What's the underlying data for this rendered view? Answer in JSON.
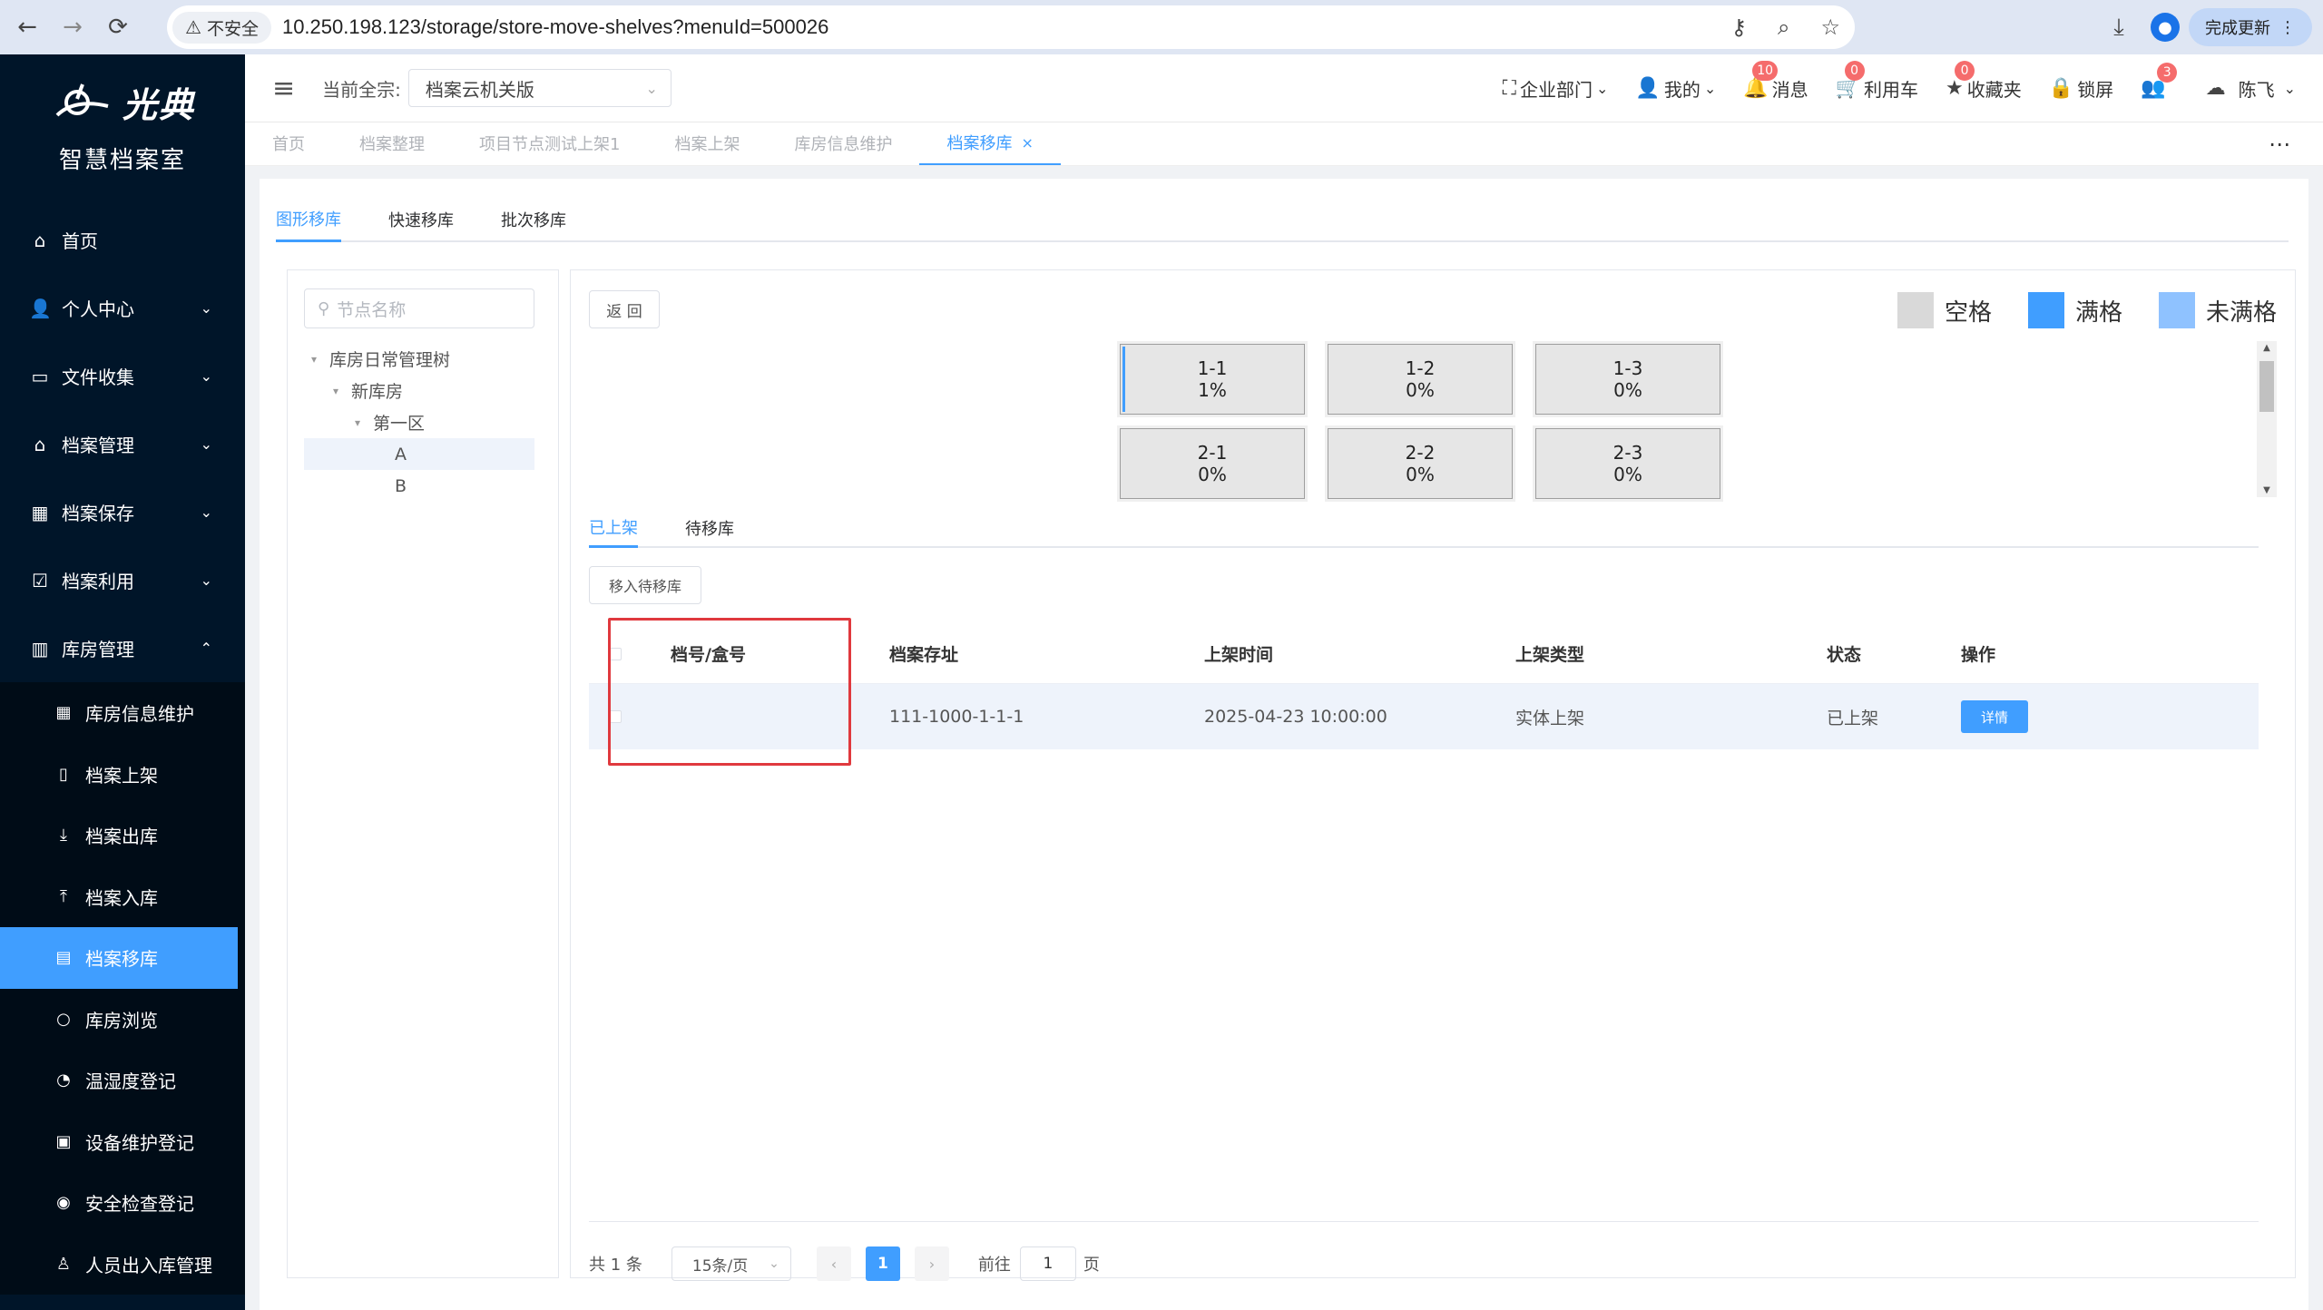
{
  "browser": {
    "security_label": "不安全",
    "url": "10.250.198.123/storage/store-move-shelves?menuId=500026",
    "update_label": "完成更新"
  },
  "sidebar": {
    "logo_text": "光典",
    "brand": "智慧档案室",
    "items": [
      {
        "label": "首页",
        "icon": "home-icon"
      },
      {
        "label": "个人中心",
        "icon": "user-icon"
      },
      {
        "label": "文件收集",
        "icon": "briefcase-icon"
      },
      {
        "label": "档案管理",
        "icon": "bank-icon"
      },
      {
        "label": "档案保存",
        "icon": "building-icon"
      },
      {
        "label": "档案利用",
        "icon": "clipboard-icon"
      },
      {
        "label": "库房管理",
        "icon": "warehouse-icon"
      }
    ],
    "sub_items": [
      {
        "label": "库房信息维护",
        "icon": "building-icon"
      },
      {
        "label": "档案上架",
        "icon": "file-icon"
      },
      {
        "label": "档案出库",
        "icon": "download-icon"
      },
      {
        "label": "档案入库",
        "icon": "upload-icon"
      },
      {
        "label": "档案移库",
        "icon": "shelf-icon"
      },
      {
        "label": "库房浏览",
        "icon": "search-icon"
      },
      {
        "label": "温湿度登记",
        "icon": "gauge-icon"
      },
      {
        "label": "设备维护登记",
        "icon": "device-icon"
      },
      {
        "label": "安全检查登记",
        "icon": "eye-icon"
      },
      {
        "label": "人员出入库管理",
        "icon": "person-icon"
      }
    ]
  },
  "header": {
    "qz_label": "当前全宗:",
    "qz_value": "档案云机关版",
    "dept": "企业部门",
    "mine": "我的",
    "messages": "消息",
    "messages_count": "10",
    "cart": "利用车",
    "cart_count": "0",
    "favorites": "收藏夹",
    "favorites_count": "0",
    "lock": "锁屏",
    "online_count": "3",
    "user": "陈飞"
  },
  "tabs": [
    "首页",
    "档案整理",
    "项目节点测试上架1",
    "档案上架",
    "库房信息维护",
    "档案移库"
  ],
  "main_tabs": [
    "图形移库",
    "快速移库",
    "批次移库"
  ],
  "tree": {
    "search_placeholder": "节点名称",
    "nodes": [
      "库房日常管理树",
      "新库房",
      "第一区",
      "A",
      "B"
    ]
  },
  "back_label": "返 回",
  "legend": [
    {
      "label": "空格",
      "color": "#d9d9d9"
    },
    {
      "label": "满格",
      "color": "#409eff"
    },
    {
      "label": "未满格",
      "color": "#8fc2ff"
    }
  ],
  "cells": [
    {
      "name": "1-1",
      "pct": "1%"
    },
    {
      "name": "1-2",
      "pct": "0%"
    },
    {
      "name": "1-3",
      "pct": "0%"
    },
    {
      "name": "2-1",
      "pct": "0%"
    },
    {
      "name": "2-2",
      "pct": "0%"
    },
    {
      "name": "2-3",
      "pct": "0%"
    }
  ],
  "sub_tabs": [
    "已上架",
    "待移库"
  ],
  "move_button": "移入待移库",
  "table": {
    "columns": [
      "档号/盒号",
      "档案存址",
      "上架时间",
      "上架类型",
      "状态",
      "操作"
    ],
    "rows": [
      {
        "dh": "",
        "address": "111-1000-1-1-1",
        "time": "2025-04-23 10:00:00",
        "type": "实体上架",
        "status": "已上架",
        "action": "详情"
      }
    ]
  },
  "pager": {
    "total": "共 1 条",
    "size": "15条/页",
    "page": "1",
    "goto_label": "前往",
    "goto_value": "1",
    "page_suffix": "页"
  }
}
